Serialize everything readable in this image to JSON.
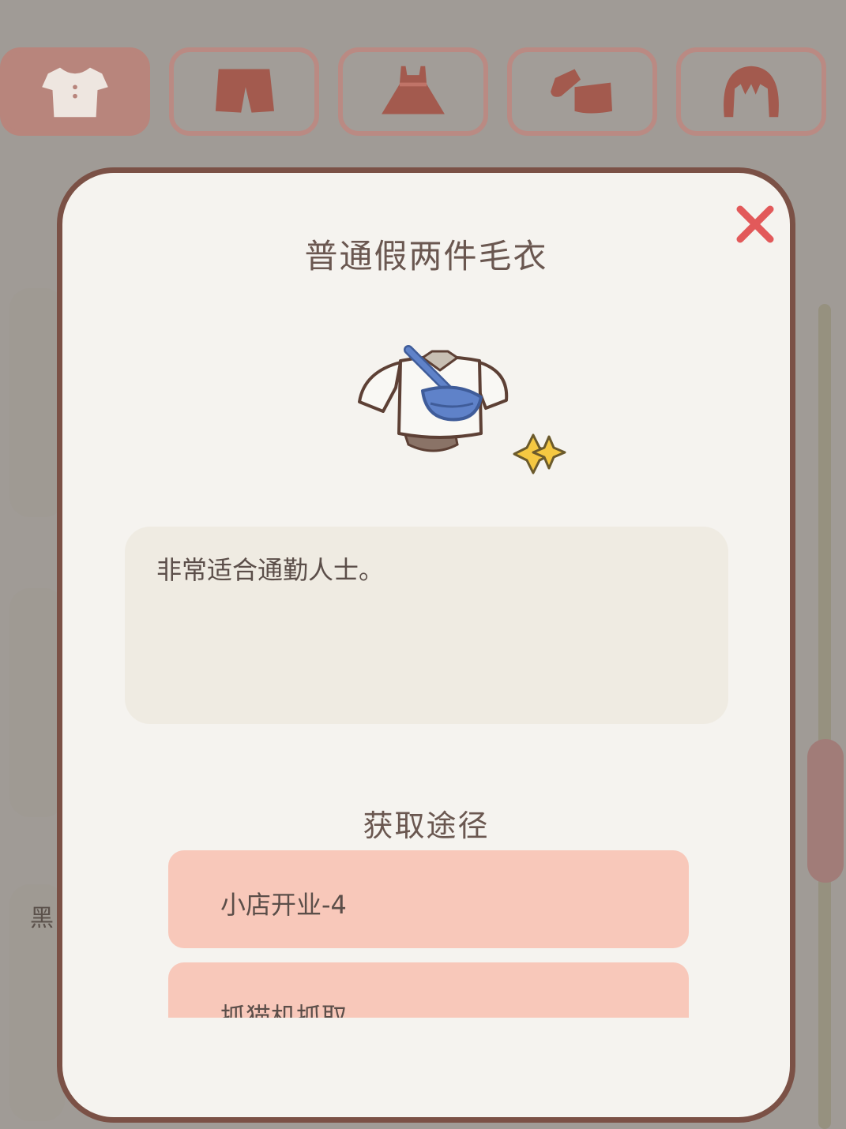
{
  "tabs": [
    {
      "id": "tops",
      "icon": "shirt-icon",
      "active": true
    },
    {
      "id": "bottoms",
      "icon": "shorts-icon",
      "active": false
    },
    {
      "id": "dresses",
      "icon": "dress-icon",
      "active": false
    },
    {
      "id": "shoes",
      "icon": "shoes-icon",
      "active": false
    },
    {
      "id": "hair",
      "icon": "hair-icon",
      "active": false
    }
  ],
  "background": {
    "partial_label": "黑"
  },
  "modal": {
    "title": "普通假两件毛衣",
    "item_icon": "sweater-with-crossbody-bag-icon",
    "description": "非常适合通勤人士。",
    "sources_title": "获取途径",
    "sources": [
      {
        "label": "小店开业-4"
      },
      {
        "label": "抓猫机抓取"
      }
    ]
  },
  "colors": {
    "modal_bg": "#f5f3ef",
    "modal_border": "#7b5146",
    "source_bg": "#f8c8ba",
    "close": "#e2595a",
    "tab_active": "#b8857c"
  }
}
